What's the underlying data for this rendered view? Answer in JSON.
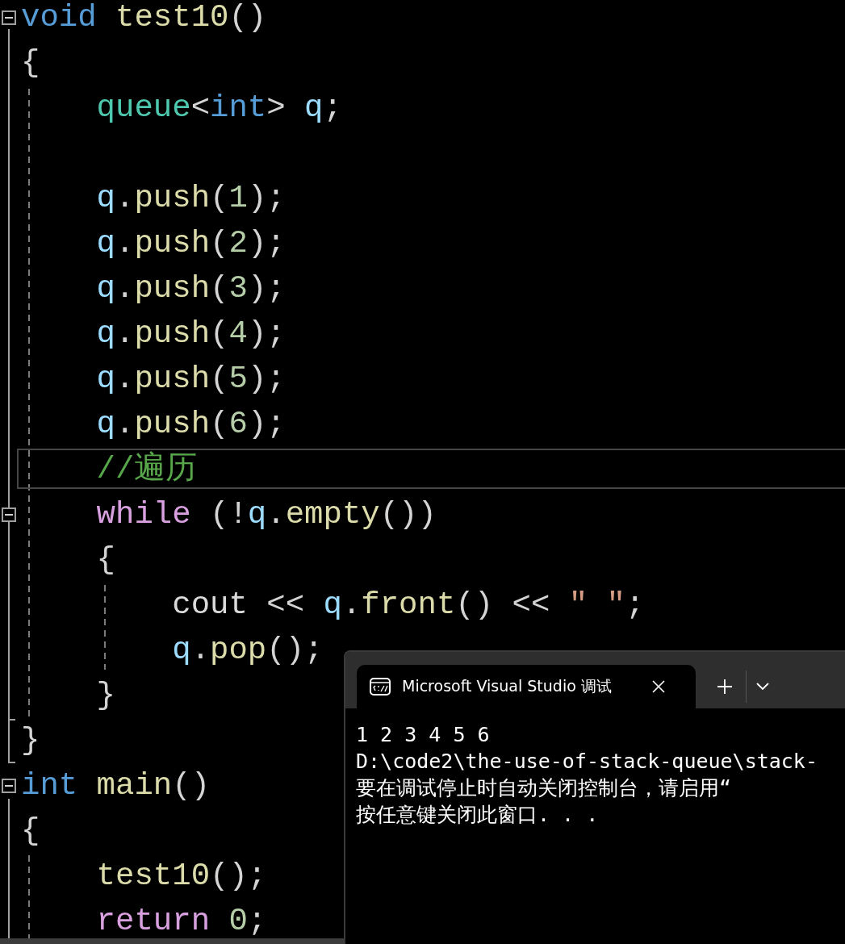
{
  "editor": {
    "lines": [
      {
        "collapsible": true,
        "current": false,
        "tokens": [
          {
            "kind": "keyword",
            "text": "void"
          },
          {
            "kind": "function",
            "text": " test10"
          },
          {
            "kind": "punctuation",
            "text": "()"
          }
        ]
      },
      {
        "collapsible": false,
        "current": false,
        "tokens": [
          {
            "kind": "punctuation",
            "text": "{"
          }
        ]
      },
      {
        "collapsible": false,
        "current": false,
        "tokens": [
          {
            "kind": "type",
            "text": "    queue"
          },
          {
            "kind": "punctuation",
            "text": "<"
          },
          {
            "kind": "keyword",
            "text": "int"
          },
          {
            "kind": "punctuation",
            "text": ">"
          },
          {
            "kind": "variable",
            "text": " q"
          },
          {
            "kind": "punctuation",
            "text": ";"
          }
        ]
      },
      {
        "collapsible": false,
        "current": false
      },
      {
        "collapsible": false,
        "current": false,
        "tokens": [
          {
            "kind": "variable",
            "text": "    q"
          },
          {
            "kind": "punctuation",
            "text": "."
          },
          {
            "kind": "function",
            "text": "push"
          },
          {
            "kind": "punctuation",
            "text": "("
          },
          {
            "kind": "number",
            "text": "1"
          },
          {
            "kind": "punctuation",
            "text": ");"
          }
        ]
      },
      {
        "collapsible": false,
        "current": false,
        "tokens": [
          {
            "kind": "variable",
            "text": "    q"
          },
          {
            "kind": "punctuation",
            "text": "."
          },
          {
            "kind": "function",
            "text": "push"
          },
          {
            "kind": "punctuation",
            "text": "("
          },
          {
            "kind": "number",
            "text": "2"
          },
          {
            "kind": "punctuation",
            "text": ");"
          }
        ]
      },
      {
        "collapsible": false,
        "current": false,
        "tokens": [
          {
            "kind": "variable",
            "text": "    q"
          },
          {
            "kind": "punctuation",
            "text": "."
          },
          {
            "kind": "function",
            "text": "push"
          },
          {
            "kind": "punctuation",
            "text": "("
          },
          {
            "kind": "number",
            "text": "3"
          },
          {
            "kind": "punctuation",
            "text": ");"
          }
        ]
      },
      {
        "collapsible": false,
        "current": false,
        "tokens": [
          {
            "kind": "variable",
            "text": "    q"
          },
          {
            "kind": "punctuation",
            "text": "."
          },
          {
            "kind": "function",
            "text": "push"
          },
          {
            "kind": "punctuation",
            "text": "("
          },
          {
            "kind": "number",
            "text": "4"
          },
          {
            "kind": "punctuation",
            "text": ");"
          }
        ]
      },
      {
        "collapsible": false,
        "current": false,
        "tokens": [
          {
            "kind": "variable",
            "text": "    q"
          },
          {
            "kind": "punctuation",
            "text": "."
          },
          {
            "kind": "function",
            "text": "push"
          },
          {
            "kind": "punctuation",
            "text": "("
          },
          {
            "kind": "number",
            "text": "5"
          },
          {
            "kind": "punctuation",
            "text": ");"
          }
        ]
      },
      {
        "collapsible": false,
        "current": false,
        "tokens": [
          {
            "kind": "variable",
            "text": "    q"
          },
          {
            "kind": "punctuation",
            "text": "."
          },
          {
            "kind": "function",
            "text": "push"
          },
          {
            "kind": "punctuation",
            "text": "("
          },
          {
            "kind": "number",
            "text": "6"
          },
          {
            "kind": "punctuation",
            "text": ");"
          }
        ]
      },
      {
        "collapsible": false,
        "current": true,
        "tokens": [
          {
            "kind": "comment",
            "text": "    //遍历"
          }
        ]
      },
      {
        "collapsible": true,
        "current": false,
        "tokens": [
          {
            "kind": "control",
            "text": "    while"
          },
          {
            "kind": "punctuation",
            "text": " (!"
          },
          {
            "kind": "variable",
            "text": "q"
          },
          {
            "kind": "punctuation",
            "text": "."
          },
          {
            "kind": "function",
            "text": "empty"
          },
          {
            "kind": "punctuation",
            "text": "())"
          }
        ]
      },
      {
        "collapsible": false,
        "current": false,
        "tokens": [
          {
            "kind": "punctuation",
            "text": "    {"
          }
        ]
      },
      {
        "collapsible": false,
        "current": false,
        "tokens": [
          {
            "kind": "stream",
            "text": "        cout"
          },
          {
            "kind": "punctuation",
            "text": " << "
          },
          {
            "kind": "variable",
            "text": "q"
          },
          {
            "kind": "punctuation",
            "text": "."
          },
          {
            "kind": "function",
            "text": "front"
          },
          {
            "kind": "punctuation",
            "text": "() << "
          },
          {
            "kind": "string",
            "text": "\" \""
          },
          {
            "kind": "punctuation",
            "text": ";"
          }
        ]
      },
      {
        "collapsible": false,
        "current": false,
        "tokens": [
          {
            "kind": "variable",
            "text": "        q"
          },
          {
            "kind": "punctuation",
            "text": "."
          },
          {
            "kind": "function",
            "text": "pop"
          },
          {
            "kind": "punctuation",
            "text": "();"
          }
        ]
      },
      {
        "collapsible": false,
        "current": false,
        "tokens": [
          {
            "kind": "punctuation",
            "text": "    }"
          }
        ]
      },
      {
        "collapsible": false,
        "current": false,
        "tokens": [
          {
            "kind": "punctuation",
            "text": "}"
          }
        ]
      },
      {
        "collapsible": true,
        "current": false,
        "tokens": [
          {
            "kind": "keyword",
            "text": "int"
          },
          {
            "kind": "function",
            "text": " main"
          },
          {
            "kind": "punctuation",
            "text": "()"
          }
        ]
      },
      {
        "collapsible": false,
        "current": false,
        "tokens": [
          {
            "kind": "punctuation",
            "text": "{"
          }
        ]
      },
      {
        "collapsible": false,
        "current": false,
        "tokens": [
          {
            "kind": "function",
            "text": "    test10"
          },
          {
            "kind": "punctuation",
            "text": "();"
          }
        ]
      },
      {
        "collapsible": false,
        "current": false,
        "tokens": [
          {
            "kind": "control",
            "text": "    return"
          },
          {
            "kind": "number",
            "text": " 0"
          },
          {
            "kind": "punctuation",
            "text": ";"
          }
        ]
      }
    ]
  },
  "console": {
    "tab": {
      "title": "Microsoft Visual Studio 调试",
      "selected": true
    },
    "output": [
      "1 2 3 4 5 6",
      "D:\\code2\\the-use-of-stack-queue\\stack-",
      "要在调试停止时自动关闭控制台，请启用“",
      "按任意键关闭此窗口. . ."
    ]
  }
}
